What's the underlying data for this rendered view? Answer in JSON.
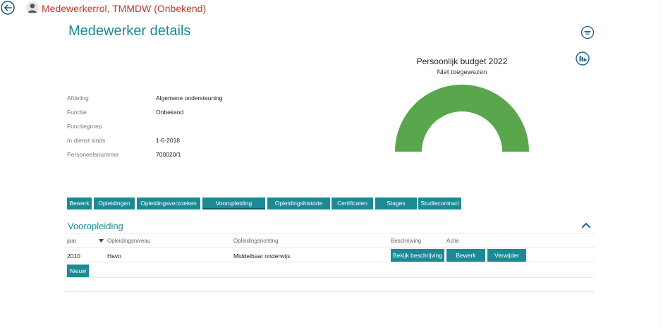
{
  "header": {
    "role_title": "Medewerkerrol, TMMDW (Onbekend)"
  },
  "page": {
    "title": "Medewerker details"
  },
  "budget": {
    "title": "Persoonlijk budget 2022",
    "subtitle": "Niet toegewezen",
    "gauge_fraction": 1.0,
    "gauge_color": "#5aa64c"
  },
  "details": [
    {
      "label": "Afdeling",
      "value": "Algemene ondersteuning"
    },
    {
      "label": "Functie",
      "value": "Onbekend"
    },
    {
      "label": "Functiegroep",
      "value": ""
    },
    {
      "label": "In dienst sinds",
      "value": "1-6-2018"
    },
    {
      "label": "Personeelsnummer",
      "value": "700020/1"
    }
  ],
  "tabs": [
    {
      "label": "Bewerk"
    },
    {
      "label": "Opleidingen"
    },
    {
      "label": "Opleidingsverzoeken"
    },
    {
      "label": "Vooropleiding",
      "active": true
    },
    {
      "label": "Opleidingshistorie"
    },
    {
      "label": "Certificaten"
    },
    {
      "label": "Stages"
    },
    {
      "label": "Studiecontract"
    }
  ],
  "section": {
    "title": "Vooropleiding"
  },
  "table": {
    "columns": [
      "jaar",
      "Opleidingsniveau",
      "Opleidingsrichting",
      "Beschrijving",
      "Actie"
    ],
    "rows": [
      {
        "jaar": "2010",
        "niveau": "Havo",
        "richting": "Middelbaar onderwijs",
        "beschrijving_button": "Bekijk beschrijving",
        "edit_button": "Bewerk",
        "delete_button": "Verwijder"
      }
    ],
    "new_button": "Nieuw"
  },
  "colors": {
    "accent": "#1b8a94",
    "title": "#1f8a97",
    "role": "#c0392b"
  }
}
